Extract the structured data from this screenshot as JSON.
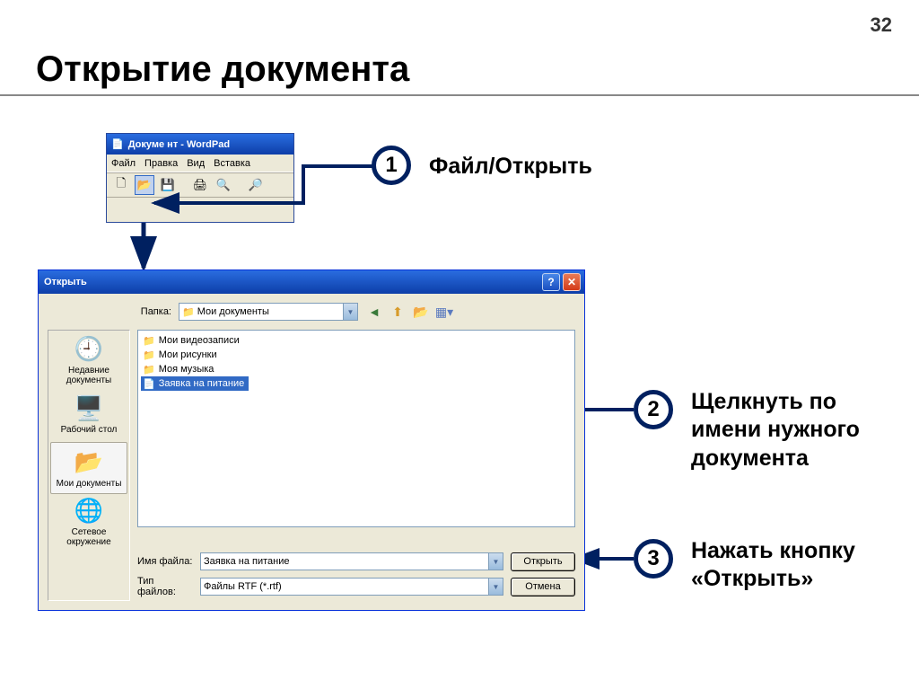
{
  "page_number": "32",
  "title": "Открытие документа",
  "wordpad": {
    "title": "Докуме нт - WordPad",
    "menu": {
      "file": "Файл",
      "edit": "Правка",
      "view": "Вид",
      "insert": "Вставка"
    }
  },
  "open_dialog": {
    "title": "Открыть",
    "folder_label": "Папка:",
    "folder_value": "Мои документы",
    "places": {
      "recent": "Недавние документы",
      "desktop": "Рабочий стол",
      "mydocs": "Мои документы",
      "network": "Сетевое окружение"
    },
    "files": {
      "videos": "Мои видеозаписи",
      "pictures": "Мои рисунки",
      "music": "Моя музыка",
      "selected_doc": "Заявка на питание"
    },
    "filename_label": "Имя файла:",
    "filename_value": "Заявка на питание",
    "filetype_label": "Тип файлов:",
    "filetype_value": "Файлы RTF (*.rtf)",
    "open_btn": "Открыть",
    "cancel_btn": "Отмена"
  },
  "callouts": {
    "b1": "1",
    "t1": "Файл/Открыть",
    "b2": "2",
    "t2": "Щелкнуть по имени нужного документа",
    "b3": "3",
    "t3": "Нажать кнопку «Открыть»"
  }
}
